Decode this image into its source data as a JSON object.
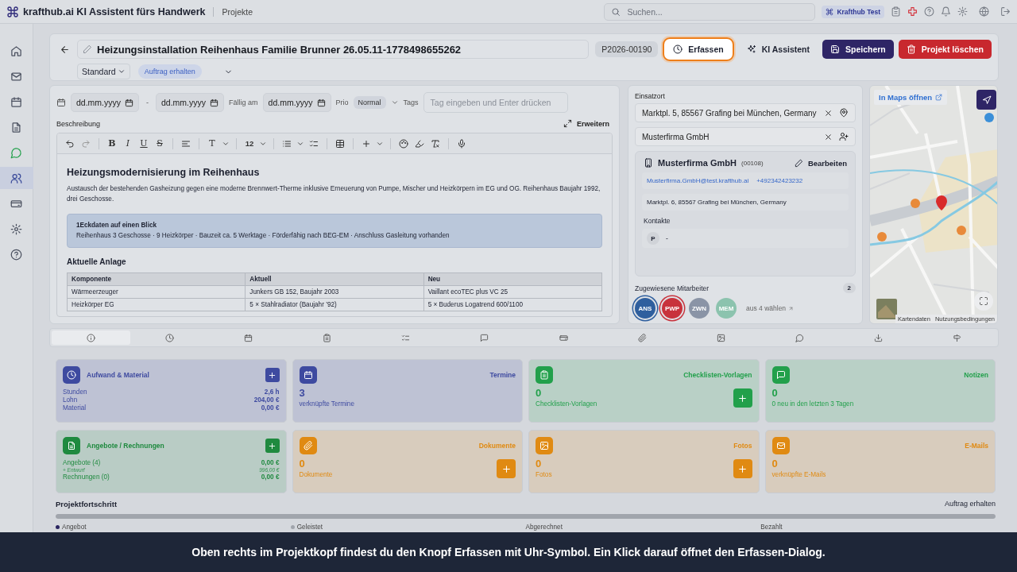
{
  "topbar": {
    "app_title": "krafthub.ai KI Assistent fürs Handwerk",
    "section": "Projekte",
    "search": {
      "placeholder": "Suchen..."
    },
    "workspace": "Krafthub Test"
  },
  "sidebar": {
    "items": [
      {
        "selected": false
      },
      {
        "selected": false
      },
      {
        "selected": false
      },
      {
        "selected": false
      },
      {
        "selected": false
      },
      {
        "selected": true
      },
      {
        "selected": false
      },
      {
        "selected": false
      },
      {
        "selected": false
      }
    ]
  },
  "header": {
    "title": "Heizungsinstallation Reihenhaus Familie Brunner 26.05.11-1778498655262",
    "project_number": "P2026-00190",
    "template": "Standard",
    "status": "Auftrag erhalten",
    "actions": [
      {
        "kind": "capture",
        "label": "Erfassen",
        "highlighted": true
      },
      {
        "kind": "assistant",
        "label": "KI Assistent",
        "highlighted": false
      },
      {
        "kind": "save",
        "label": "Speichern",
        "highlighted": false
      },
      {
        "kind": "delete",
        "label": "Projekt löschen",
        "highlighted": false
      }
    ]
  },
  "details": {
    "start_date": {
      "placeholder": "dd.mm.yyyy"
    },
    "separator": "-",
    "end_date": {
      "placeholder": "dd.mm.yyyy"
    },
    "due_label": "Fällig am",
    "due_date": {
      "placeholder": "dd.mm.yyyy"
    },
    "priority_label": "Prio",
    "priority": "Normal",
    "tags_label": "Tags",
    "tags": {
      "placeholder": "Tag eingeben und Enter drücken"
    },
    "description_label": "Beschreibung",
    "expand": "Erweitern"
  },
  "editor": {
    "toolbar": {
      "text_buttons": [
        "B",
        "I",
        "U",
        "S"
      ],
      "heading": "T",
      "font_size": "12"
    },
    "heading": "Heizungsmodernisierung im Reihenhaus",
    "intro": "Austausch der bestehenden Gasheizung gegen eine moderne Brennwert-Therme inklusive Erneuerung von Pumpe, Mischer und Heizkörpern im EG und OG. Reihenhaus Baujahr 1992, drei Geschosse.",
    "callout": {
      "title": "1Eckdaten auf einen Blick",
      "text": "Reihenhaus 3 Geschosse · 9 Heizkörper · Bauzeit ca. 5 Werktage · Förderfähig nach BEG-EM · Anschluss Gasleitung vorhanden"
    },
    "subheading": "Aktuelle Anlage",
    "table": {
      "columns": [
        "Komponente",
        "Aktuell",
        "Neu"
      ],
      "rows": [
        [
          "Wärmeerzeuger",
          "Junkers GB 152, Baujahr 2003",
          "Vaillant ecoTEC plus VC 25"
        ],
        [
          "Heizkörper EG",
          "5 × Stahlradiator (Baujahr ’92)",
          "5 × Buderus Logatrend 600/1100"
        ]
      ]
    }
  },
  "location": {
    "label": "Einsatzort",
    "address": "Marktpl. 5, 85567 Grafing bei München, Germany",
    "customer": "Musterfirma GmbH",
    "customer_card": {
      "name": "Musterfirma GmbH",
      "number": "(00108)",
      "edit": "Bearbeiten",
      "email": "Musterfirma.GmbH@test.krafthub.ai",
      "phone": "+492342423232",
      "address": "Marktpl. 6, 85567 Grafing bei München, Germany",
      "contacts_label": "Kontakte",
      "contacts": [
        {
          "initial": "P",
          "name": "-"
        }
      ]
    }
  },
  "team": {
    "label": "Zugewiesene Mitarbeiter",
    "count": "2",
    "choose": "aus 4 wählen",
    "members": [
      {
        "initials": "ANS",
        "color": "#2f5f9e",
        "selected": true
      },
      {
        "initials": "PWP",
        "color": "#c8323c",
        "selected": true
      },
      {
        "initials": "ZWN",
        "color": "#8a94a6",
        "selected": false
      },
      {
        "initials": "MEM",
        "color": "#8cc3ae",
        "selected": false
      }
    ]
  },
  "map": {
    "open_label": "In Maps öffnen",
    "attribution": [
      "Kartendaten",
      "Nutzungsbedingungen"
    ]
  },
  "tabs": [
    {
      "selected": true
    },
    {
      "selected": false
    },
    {
      "selected": false
    },
    {
      "selected": false
    },
    {
      "selected": false
    },
    {
      "selected": false
    },
    {
      "selected": false
    },
    {
      "selected": false
    },
    {
      "selected": false
    },
    {
      "selected": false
    },
    {
      "selected": false
    },
    {
      "selected": false
    }
  ],
  "cards": [
    {
      "kind": "stats",
      "color": "#3e4aa0",
      "title": "Aufwand & Material",
      "add_button": true,
      "rows": [
        {
          "kind": "total",
          "label": "Stunden",
          "value": "2,6 h"
        },
        {
          "kind": "total",
          "label": "Lohn",
          "value": "204,00 €"
        },
        {
          "kind": "total",
          "label": "Material",
          "value": "0,00 €"
        }
      ]
    },
    {
      "kind": "count",
      "color": "#3e4aa0",
      "title": "Termine",
      "value": "3",
      "subtitle": "verknüpfte Termine",
      "add_button": false
    },
    {
      "kind": "count",
      "color": "#22a04b",
      "title": "Checklisten-Vorlagen",
      "value": "0",
      "subtitle": "Checklisten-Vorlagen",
      "add_button": true
    },
    {
      "kind": "count",
      "color": "#22a04b",
      "title": "Notizen",
      "value": "0",
      "subtitle": "0 neu in den letzten 3 Tagen",
      "add_button": false
    },
    {
      "kind": "stats",
      "color": "#1f8a3f",
      "title": "Angebote / Rechnungen",
      "add_button": true,
      "rows": [
        {
          "kind": "total",
          "label": "Angebote (4)",
          "value": "0,00 €"
        },
        {
          "kind": "note",
          "label": "+ Entwurf",
          "value": "996,00 €"
        },
        {
          "kind": "total",
          "label": "Rechnungen (0)",
          "value": "0,00 €"
        }
      ]
    },
    {
      "kind": "count",
      "color": "#e08a12",
      "title": "Dokumente",
      "value": "0",
      "subtitle": "Dokumente",
      "add_button": true
    },
    {
      "kind": "count",
      "color": "#e08a12",
      "title": "Fotos",
      "value": "0",
      "subtitle": "Fotos",
      "add_button": true
    },
    {
      "kind": "count",
      "color": "#e08a12",
      "title": "E-Mails",
      "value": "0",
      "subtitle": "verknüpfte E-Mails",
      "add_button": false
    }
  ],
  "progress": {
    "title": "Projektfortschritt",
    "status": "Auftrag erhalten",
    "level": 1,
    "stages": [
      {
        "label": "Angebot",
        "color": "#2a2560"
      },
      {
        "label": "Geleistet",
        "color": "#a1a5ac"
      },
      {
        "label": "Abgerechnet"
      },
      {
        "label": "Bezahlt"
      }
    ]
  },
  "caption": "Oben rechts im Projektkopf findest du den Knopf Erfassen mit Uhr-Symbol. Ein Klick darauf öffnet den Erfassen-Dialog."
}
